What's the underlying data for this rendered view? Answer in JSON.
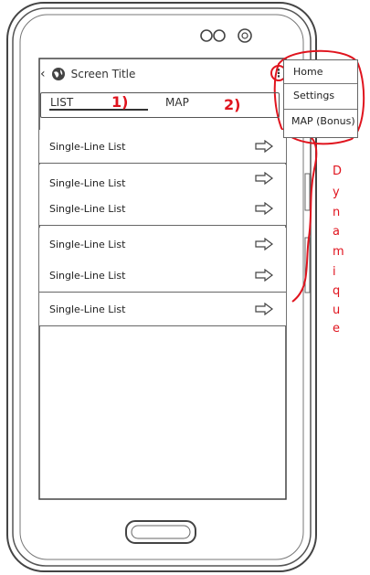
{
  "app_bar": {
    "back_glyph": "‹",
    "title": "Screen Title",
    "overflow_glyph": "⋮"
  },
  "tabs": [
    {
      "label": "LIST",
      "marker": "1)"
    },
    {
      "label": "MAP",
      "marker": "2)"
    }
  ],
  "list": {
    "items": [
      {
        "label": "Single-Line List"
      },
      {
        "label": "Single-Line List"
      },
      {
        "label": "Single-Line List"
      },
      {
        "label": "Single-Line List"
      },
      {
        "label": "Single-Line List"
      },
      {
        "label": "Single-Line List"
      }
    ]
  },
  "menu": {
    "items": [
      {
        "label": "Home"
      },
      {
        "label": "Settings"
      },
      {
        "label": "MAP (Bonus)"
      }
    ]
  },
  "annotation": {
    "letters": [
      "D",
      "y",
      "n",
      "a",
      "m",
      "i",
      "q",
      "u",
      "e"
    ],
    "color": "#e0141e"
  }
}
